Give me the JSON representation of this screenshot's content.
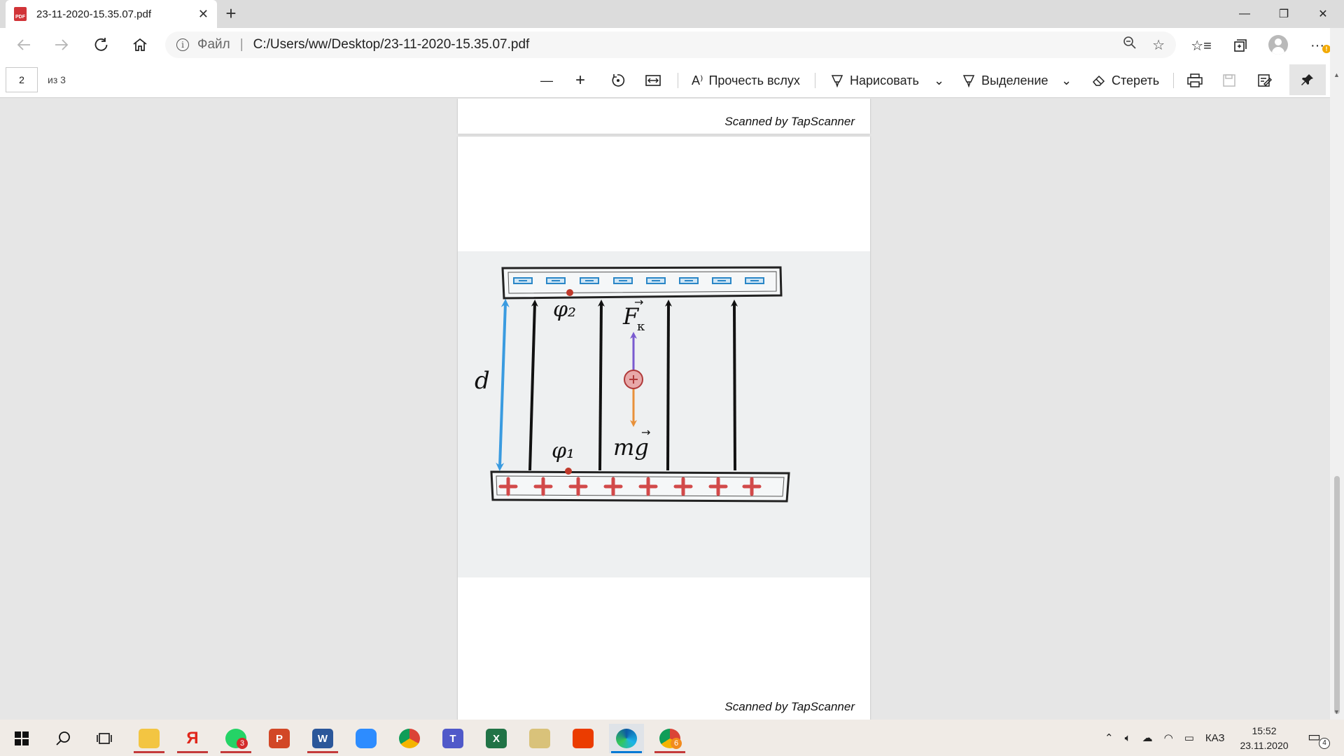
{
  "browser": {
    "tab_title": "23-11-2020-15.35.07.pdf",
    "tab_close": "✕",
    "new_tab": "+",
    "window_controls": {
      "minimize": "—",
      "restore": "❐",
      "close": "✕"
    },
    "address": {
      "scheme_label": "Файл",
      "separator": "|",
      "url": "C:/Users/ww/Desktop/23-11-2020-15.35.07.pdf"
    },
    "profile_warning": "!"
  },
  "pdf_toolbar": {
    "page_current": "2",
    "page_total": "из 3",
    "read_aloud": "Прочесть вслух",
    "draw": "Нарисовать",
    "highlight": "Выделение",
    "erase": "Стереть"
  },
  "document": {
    "watermark_page1": "Scanned by TapScanner",
    "watermark_page2": "Scanned by TapScanner",
    "figure": {
      "phi2_label": "φ₂",
      "phi1_label": "φ₁",
      "force_label": "F",
      "force_subscript": "к",
      "gravity_label": "mg",
      "distance_label": "d",
      "arrow_mark": "→"
    }
  },
  "taskbar": {
    "badges": {
      "whatsapp": "3",
      "chrome2": "6"
    },
    "language": "КАЗ",
    "time": "15:52",
    "date": "23.11.2020",
    "notifications": "4"
  },
  "colors": {
    "accent": "#0078d4",
    "negative_charge": "#2b87c7",
    "positive_charge": "#d24a4a",
    "force_arrow": "#7a5bd0",
    "gravity_arrow": "#e8913a",
    "distance_arrow": "#3a9be0"
  }
}
